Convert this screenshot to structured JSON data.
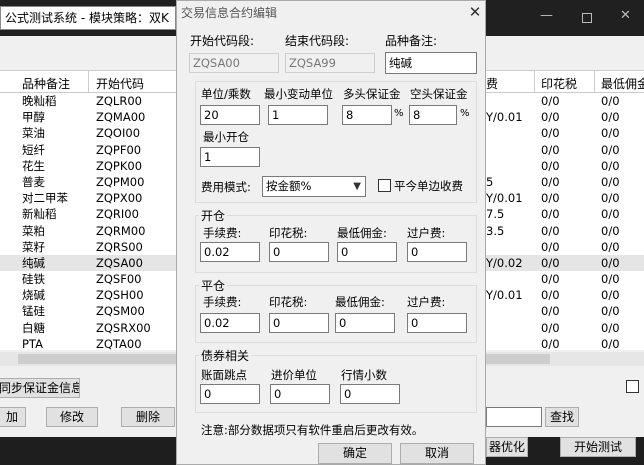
{
  "main_window": {
    "title": "公式测试系统 - 模块策略：双K",
    "left_table": {
      "headers": [
        "品种备注",
        "开始代码"
      ],
      "rows": [
        {
          "name": "晚籼稻",
          "code": "ZQLR00"
        },
        {
          "name": "甲醇",
          "code": "ZQMA00"
        },
        {
          "name": "菜油",
          "code": "ZQOI00"
        },
        {
          "name": "短纤",
          "code": "ZQPF00"
        },
        {
          "name": "花生",
          "code": "ZQPK00"
        },
        {
          "name": "普麦",
          "code": "ZQPM00"
        },
        {
          "name": "对二甲苯",
          "code": "ZQPX00"
        },
        {
          "name": "新籼稻",
          "code": "ZQRI00"
        },
        {
          "name": "菜粕",
          "code": "ZQRM00"
        },
        {
          "name": "菜籽",
          "code": "ZQRS00"
        },
        {
          "name": "纯碱",
          "code": "ZQSA00"
        },
        {
          "name": "硅铁",
          "code": "ZQSF00"
        },
        {
          "name": "烧碱",
          "code": "ZQSH00"
        },
        {
          "name": "锰硅",
          "code": "ZQSM00"
        },
        {
          "name": "白糖",
          "code": "ZQSRX00"
        },
        {
          "name": "PTA",
          "code": "ZQTA00"
        }
      ],
      "selected_index": 10
    },
    "right_table": {
      "headers": [
        "费",
        "印花税",
        "最低佣金"
      ],
      "rows": [
        {
          "fee": "",
          "stamp": "0/0",
          "min": "0/0"
        },
        {
          "fee": "Y/0.01",
          "stamp": "0/0",
          "min": "0/0"
        },
        {
          "fee": "",
          "stamp": "0/0",
          "min": "0/0"
        },
        {
          "fee": "",
          "stamp": "0/0",
          "min": "0/0"
        },
        {
          "fee": "",
          "stamp": "0/0",
          "min": "0/0"
        },
        {
          "fee": "5",
          "stamp": "0/0",
          "min": "0/0"
        },
        {
          "fee": "Y/0.01",
          "stamp": "0/0",
          "min": "0/0"
        },
        {
          "fee": "7.5",
          "stamp": "0/0",
          "min": "0/0"
        },
        {
          "fee": "3.5",
          "stamp": "0/0",
          "min": "0/0"
        },
        {
          "fee": "",
          "stamp": "0/0",
          "min": "0/0"
        },
        {
          "fee": "Y/0.02",
          "stamp": "0/0",
          "min": "0/0"
        },
        {
          "fee": "",
          "stamp": "0/0",
          "min": "0/0"
        },
        {
          "fee": "Y/0.01",
          "stamp": "0/0",
          "min": "0/0"
        },
        {
          "fee": "",
          "stamp": "0/0",
          "min": "0/0"
        },
        {
          "fee": "",
          "stamp": "0/0",
          "min": "0/0"
        },
        {
          "fee": "",
          "stamp": "0/0",
          "min": "0/0"
        }
      ]
    },
    "buttons": {
      "sync_margin": "同步保证金信息",
      "add": "加",
      "edit": "修改",
      "delete": "删除",
      "search": "查找",
      "optimize": "器优化",
      "start_test": "开始测试"
    }
  },
  "dialog": {
    "title": "交易信息合约编辑",
    "close_glyph": "✕",
    "start_code_label": "开始代码段:",
    "start_code_value": "ZQSA00",
    "end_code_label": "结束代码段:",
    "end_code_value": "ZQSA99",
    "remark_label": "品种备注:",
    "remark_value": "纯碱",
    "unit_label": "单位/乘数",
    "unit_value": "20",
    "min_tick_label": "最小变动单位",
    "min_tick_value": "1",
    "long_margin_label": "多头保证金",
    "long_margin_value": "8",
    "short_margin_label": "空头保证金",
    "short_margin_value": "8",
    "percent_sign": "%",
    "min_open_label": "最小开仓",
    "min_open_value": "1",
    "fee_mode_label": "费用模式:",
    "fee_mode_value": "按金额%",
    "close_today_label": "平今单边收费",
    "open_group": {
      "title": "开仓",
      "fee_label": "手续费:",
      "fee_value": "0.02",
      "stamp_label": "印花税:",
      "stamp_value": "0",
      "min_comm_label": "最低佣金:",
      "min_comm_value": "0",
      "transfer_label": "过户费:",
      "transfer_value": "0"
    },
    "close_group": {
      "title": "平仓",
      "fee_label": "手续费:",
      "fee_value": "0.02",
      "stamp_label": "印花税:",
      "stamp_value": "0",
      "min_comm_label": "最低佣金:",
      "min_comm_value": "0",
      "transfer_label": "过户费:",
      "transfer_value": "0"
    },
    "bond_group": {
      "title": "债券相关",
      "tick_label": "账面跳点",
      "tick_value": "0",
      "price_unit_label": "进价单位",
      "price_unit_value": "0",
      "quote_dec_label": "行情小数",
      "quote_dec_value": "0"
    },
    "note": "注意:部分数据项只有软件重启后更改有效。",
    "ok_label": "确定",
    "cancel_label": "取消"
  }
}
